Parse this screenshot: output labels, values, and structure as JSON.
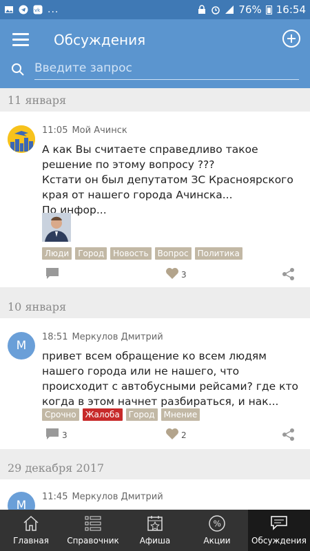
{
  "statusbar": {
    "dots": "...",
    "battery": "76%",
    "time": "16:54"
  },
  "header": {
    "title": "Обсуждения",
    "search_placeholder": "Введите запрос"
  },
  "feed": [
    {
      "date": "11 января",
      "posts": [
        {
          "time": "11:05",
          "author": "Мой Ачинск",
          "text": [
            "А как Вы считаете справедливо такое решение по этому вопросу ???",
            "Кстати он был депутатом ЗС Красноярского края от нашего города Ачинска...",
            "По инфор..."
          ],
          "tags": [
            "Люди",
            "Город",
            "Новость",
            "Вопрос",
            "Политика"
          ],
          "comments": "",
          "likes": "3"
        }
      ]
    },
    {
      "date": "10 января",
      "posts": [
        {
          "avatar_letter": "М",
          "time": "18:51",
          "author": "Меркулов Дмитрий",
          "text": [
            "привет всем обращение ко всем людям нашего города или не нашего, что происходит с автобусными рейсами? где кто когда в этом начнет разбираться, и нак..."
          ],
          "tags": [
            "Срочно",
            "Жалоба",
            "Город",
            "Мнение"
          ],
          "comments": "3",
          "likes": "2"
        }
      ]
    },
    {
      "date": "29 декабря 2017",
      "posts": [
        {
          "avatar_letter": "М",
          "time": "11:45",
          "author": "Меркулов Дмитрий"
        }
      ]
    }
  ],
  "nav": [
    {
      "label": "Главная",
      "icon": "house-icon"
    },
    {
      "label": "Справочник",
      "icon": "list-icon"
    },
    {
      "label": "Афиша",
      "icon": "calendar-star-icon"
    },
    {
      "label": "Акции",
      "icon": "percent-icon"
    },
    {
      "label": "Обсуждения",
      "icon": "chat-icon",
      "active": true
    }
  ],
  "colors": {
    "statusbar": "#3f79b5",
    "appbar": "#5b95cf",
    "tag": "#c2b8a5",
    "tag_red": "#c72a2a",
    "bottomnav": "#333333"
  }
}
